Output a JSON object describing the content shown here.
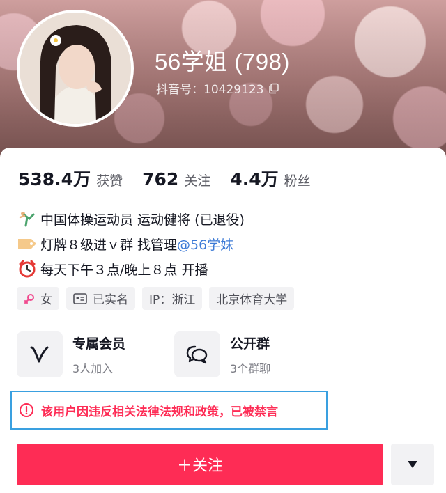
{
  "profile": {
    "nickname": "56学姐 (798)",
    "douyin_id": "抖音号：10429123",
    "avatar_icon": "user-avatar-photo"
  },
  "stats": [
    {
      "value": "538.4万",
      "label": "获赞"
    },
    {
      "value": "762",
      "label": "关注"
    },
    {
      "value": "4.4万",
      "label": "粉丝"
    }
  ],
  "bio": {
    "line1": "中国体操运动员 运动健将 (已退役)",
    "line2_text": "灯牌８级进ｖ群 找管理 ",
    "line2_mention": "@56学妹",
    "line3": "每天下午３点/晚上８点 开播",
    "emojis": [
      "gymnast-emoji",
      "label-tag-emoji",
      "alarm-clock-emoji"
    ]
  },
  "tags": {
    "gender": "女",
    "verified": "已实名",
    "ip": "IP：浙江",
    "school": "北京体育大学"
  },
  "features": {
    "membership_title": "专属会员",
    "membership_sub": "3人加入",
    "group_title": "公开群",
    "group_sub": "3个群聊"
  },
  "notice": {
    "ban_text": "该用户因违反相关法律法规和政策，已被禁言"
  },
  "actions": {
    "follow_label": "＋关注"
  },
  "colors": {
    "brand_red": "#fe2c55",
    "mention_blue": "#3c7ad6",
    "highlight_border": "#3aa0e0"
  }
}
